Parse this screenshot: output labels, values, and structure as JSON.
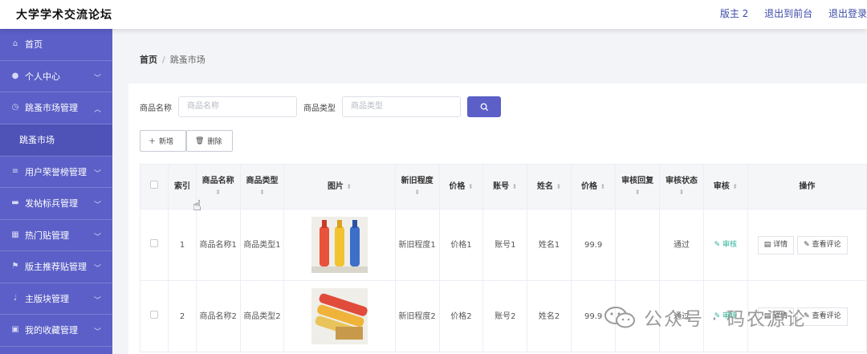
{
  "header": {
    "site_title": "大学学术交流论坛",
    "user_label": "版主 2",
    "back_front_label": "退出到前台",
    "logout_label": "退出登录"
  },
  "sidebar": {
    "items": [
      {
        "label": "首页",
        "icon": "home-icon"
      },
      {
        "label": "个人中心",
        "icon": "user-icon"
      },
      {
        "label": "跳蚤市场管理",
        "icon": "clock-icon"
      },
      {
        "label": "跳蚤市场",
        "icon": ""
      },
      {
        "label": "用户荣誉榜管理",
        "icon": "list-icon"
      },
      {
        "label": "发帖标兵管理",
        "icon": "monitor-icon"
      },
      {
        "label": "热门贴管理",
        "icon": "grid-icon"
      },
      {
        "label": "版主推荐贴管理",
        "icon": "flag-icon"
      },
      {
        "label": "主版块管理",
        "icon": "mic-icon"
      },
      {
        "label": "我的收藏管理",
        "icon": "collect-icon"
      }
    ]
  },
  "breadcrumb": {
    "home": "首页",
    "separator": "/",
    "current": "跳蚤市场"
  },
  "search": {
    "name_label": "商品名称",
    "name_placeholder": "商品名称",
    "type_label": "商品类型",
    "type_placeholder": "商品类型"
  },
  "toolbar": {
    "add_label": "新增",
    "delete_label": "删除"
  },
  "table": {
    "headers": [
      "索引",
      "商品名称",
      "商品类型",
      "图片",
      "新旧程度",
      "价格",
      "账号",
      "姓名",
      "价格",
      "审核回复",
      "审核状态",
      "审核",
      "操作"
    ],
    "rows": [
      {
        "index": "1",
        "name": "商品名称1",
        "type": "商品类型1",
        "condition": "新旧程度1",
        "price": "价格1",
        "account": "账号1",
        "realname": "姓名1",
        "price2": "99.9",
        "reply": "",
        "status": "通过",
        "review": "审核",
        "detail": "详情",
        "comments": "查看评论"
      },
      {
        "index": "2",
        "name": "商品名称2",
        "type": "商品类型2",
        "condition": "新旧程度2",
        "price": "价格2",
        "account": "账号2",
        "realname": "姓名2",
        "price2": "99.9",
        "reply": "",
        "status": "通过",
        "review": "审核",
        "detail": "详情",
        "comments": "查看评论"
      }
    ]
  },
  "watermark": {
    "text": "公众号 · 码农源论"
  },
  "colors": {
    "accent": "#5b5fc7",
    "review": "#2bb398",
    "link": "#3c4ba8"
  }
}
